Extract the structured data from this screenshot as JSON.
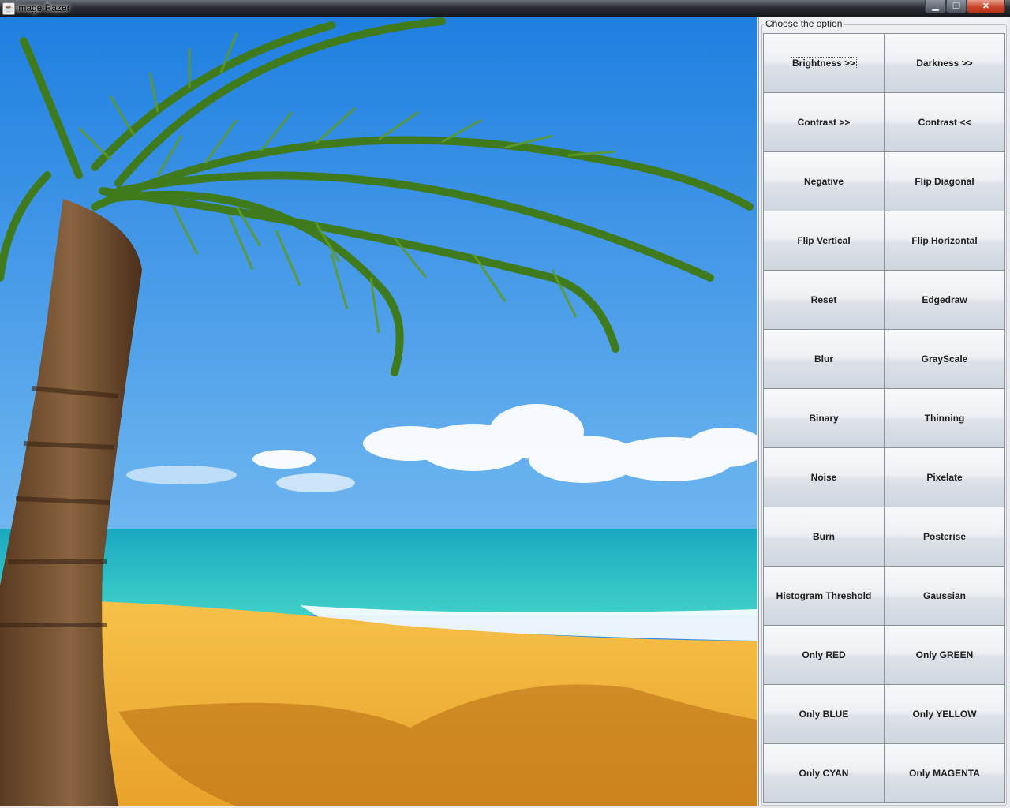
{
  "window": {
    "title": "Image Razer",
    "app_icon": "java-cup-icon",
    "controls": {
      "minimize": "minimize-icon",
      "maximize": "maximize-icon",
      "close": "close-icon"
    }
  },
  "panel": {
    "title": "Choose the option",
    "buttons": [
      "Brightness >>",
      "Darkness >>",
      "Contrast >>",
      "Contrast <<",
      "Negative",
      "Flip Diagonal",
      "Flip Vertical",
      "Flip Horizontal",
      "Reset",
      "Edgedraw",
      "Blur",
      "GrayScale",
      "Binary",
      "Thinning",
      "Noise",
      "Pixelate",
      "Burn",
      "Posterise",
      "Histogram Threshold",
      "Gaussian",
      "Only RED",
      "Only GREEN",
      "Only BLUE",
      "Only YELLOW",
      "Only CYAN",
      "Only MAGENTA"
    ],
    "focused_index": 0
  },
  "colors": {
    "sky": "#2a8ee6",
    "sea": "#2ec4c4",
    "sand": "#f2b63a"
  }
}
